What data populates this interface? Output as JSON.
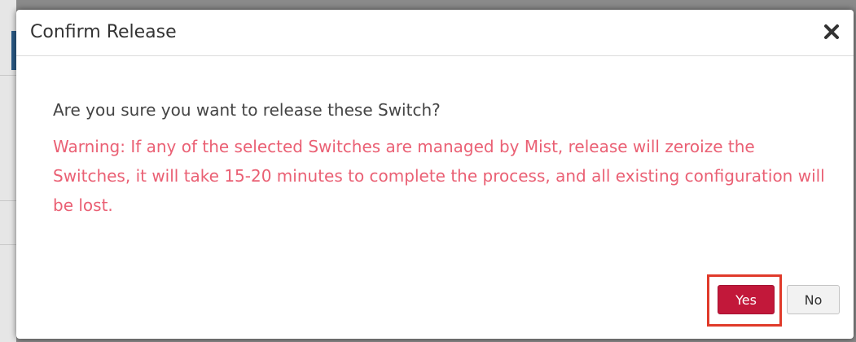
{
  "dialog": {
    "title": "Confirm Release",
    "close_icon": "close-icon",
    "question": "Are you sure you want to release these Switch?",
    "warning": "Warning: If any of the selected Switches are managed by Mist, release will zeroize the Switches, it will take 15-20 minutes to complete the process, and all existing configuration will be lost.",
    "buttons": {
      "yes_label": "Yes",
      "no_label": "No"
    }
  },
  "colors": {
    "warning_text": "#ea6074",
    "yes_button": "#c2183a",
    "highlight_border": "#e03a2a"
  }
}
